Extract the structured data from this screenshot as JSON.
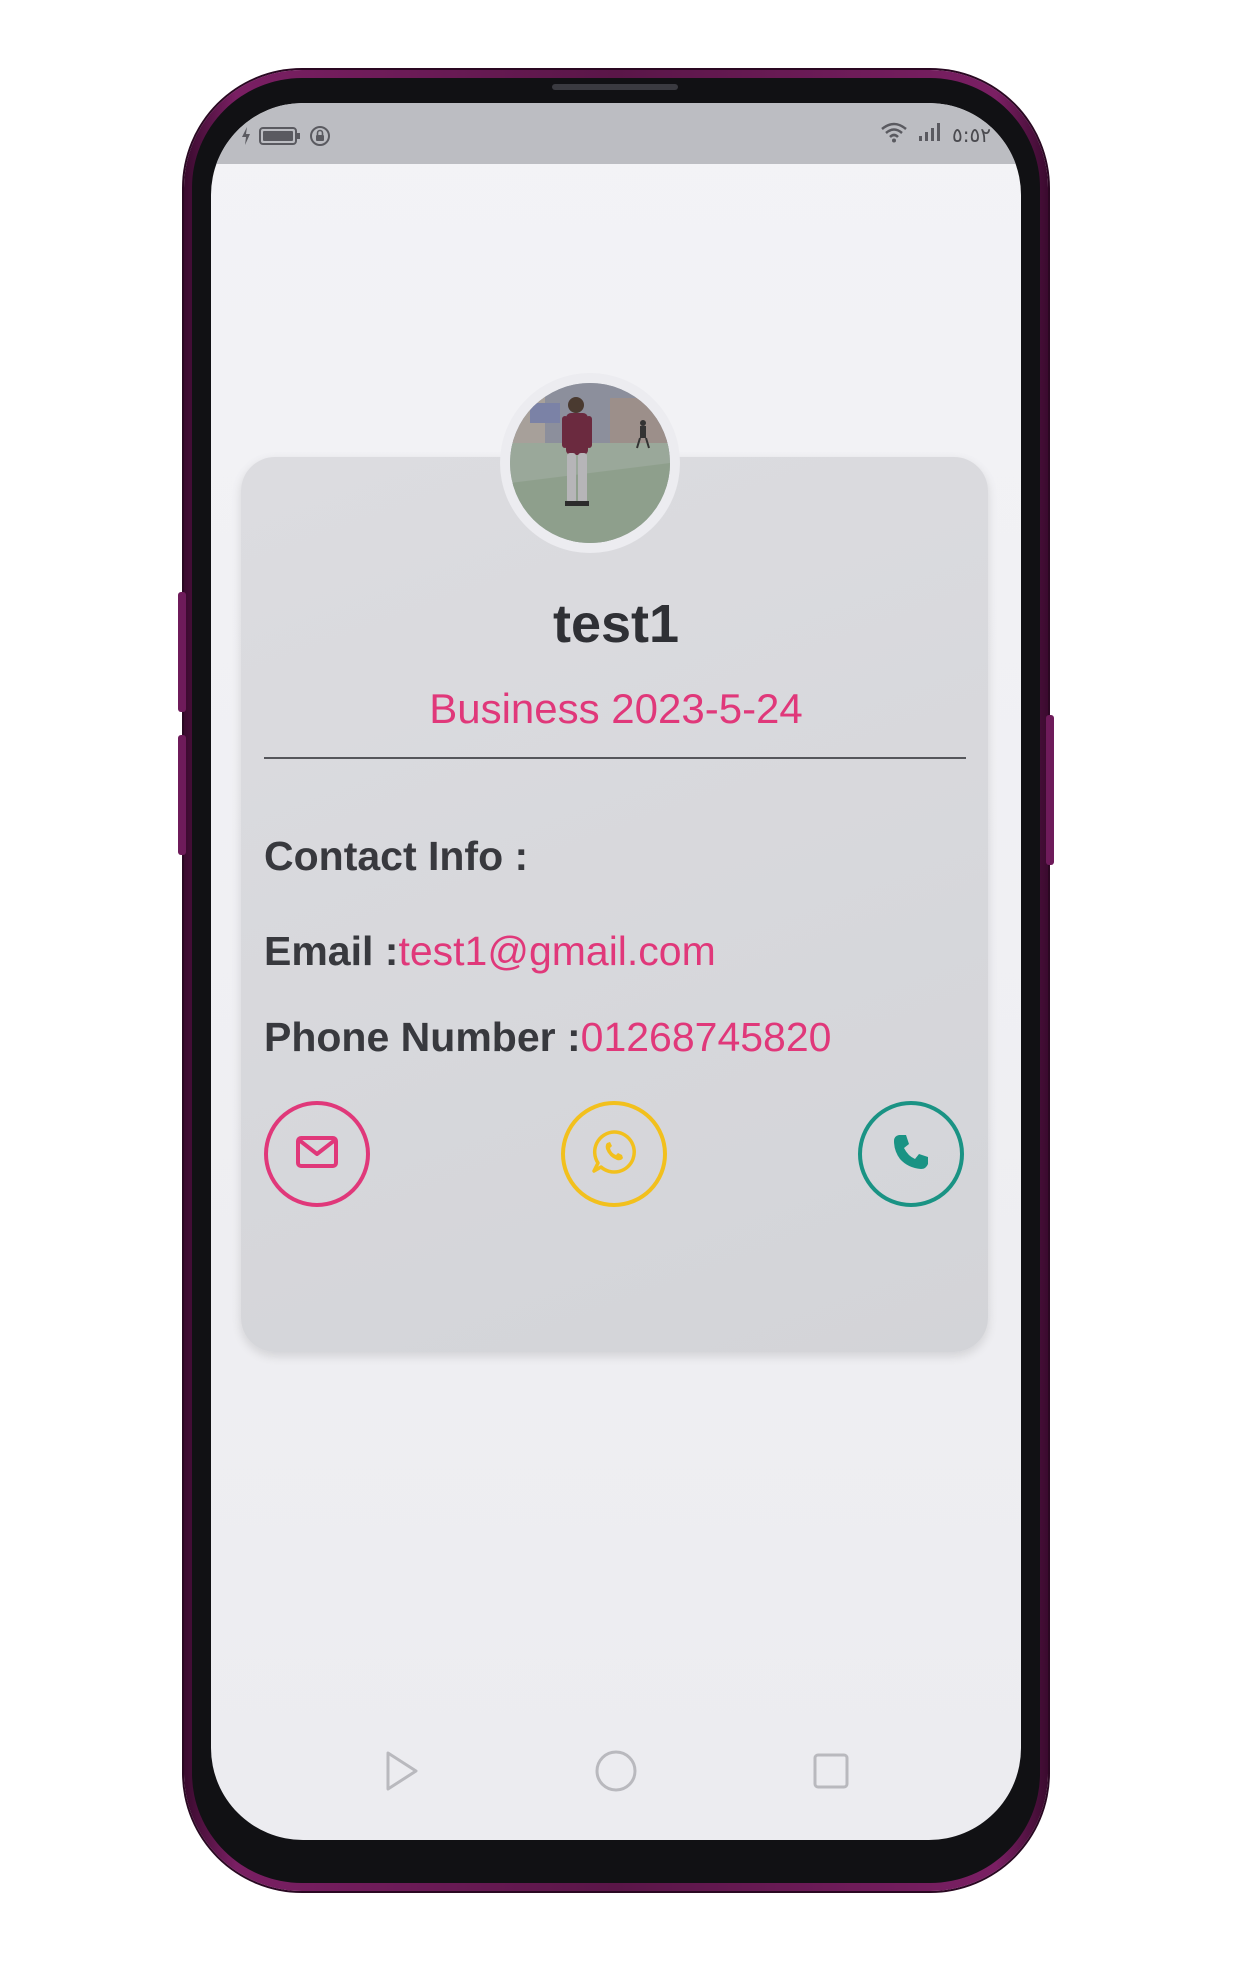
{
  "status_bar": {
    "time": "٥:٥٢",
    "icons": [
      "charging-icon",
      "battery-icon",
      "lock-rotation-icon",
      "wifi-icon",
      "signal-icon"
    ]
  },
  "profile": {
    "name": "test1",
    "subtitle": "Business 2023-5-24"
  },
  "contact": {
    "heading": "Contact Info :",
    "email_label": "Email :",
    "email_value": "test1@gmail.com",
    "phone_label": "Phone Number :",
    "phone_value": "01268745820"
  },
  "actions": [
    {
      "icon": "mail-icon",
      "color": "#e0387a"
    },
    {
      "icon": "whatsapp-icon",
      "color": "#f2c01d"
    },
    {
      "icon": "phone-icon",
      "color": "#1a9384"
    }
  ],
  "nav": {
    "icons": [
      "back-triangle-icon",
      "home-circle-icon",
      "recents-square-icon"
    ]
  },
  "colors": {
    "accent": "#e0387a",
    "frame": "#5a1648",
    "card": "#d6d7db"
  }
}
